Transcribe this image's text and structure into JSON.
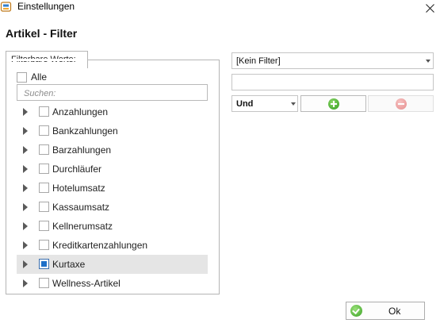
{
  "window": {
    "title": "Einstellungen"
  },
  "heading": "Artikel - Filter",
  "filter_group": {
    "label": "Filterbare Werte:",
    "select_all": {
      "label": "Alle",
      "checked": false
    },
    "search": {
      "placeholder": "Suchen:",
      "value": ""
    },
    "items": [
      {
        "label": "Anzahlungen",
        "checked": false,
        "selected": false
      },
      {
        "label": "Bankzahlungen",
        "checked": false,
        "selected": false
      },
      {
        "label": "Barzahlungen",
        "checked": false,
        "selected": false
      },
      {
        "label": "Durchläufer",
        "checked": false,
        "selected": false
      },
      {
        "label": "Hotelumsatz",
        "checked": false,
        "selected": false
      },
      {
        "label": "Kassaumsatz",
        "checked": false,
        "selected": false
      },
      {
        "label": "Kellnerumsatz",
        "checked": false,
        "selected": false
      },
      {
        "label": "Kreditkartenzahlungen",
        "checked": false,
        "selected": false
      },
      {
        "label": "Kurtaxe",
        "checked": true,
        "selected": true
      },
      {
        "label": "Wellness-Artikel",
        "checked": false,
        "selected": false
      }
    ]
  },
  "filter_controls": {
    "filter_select_value": "[Kein Filter]",
    "filter_text_value": "",
    "operator_value": "Und",
    "add_icon": "plus-icon",
    "remove_icon": "minus-icon"
  },
  "footer": {
    "ok_label": "Ok"
  },
  "colors": {
    "accent_check": "#1e6fc8",
    "add_green": "#2e9b1c",
    "remove_red": "#e58c8c",
    "selected_row": "#e5e5e5"
  }
}
